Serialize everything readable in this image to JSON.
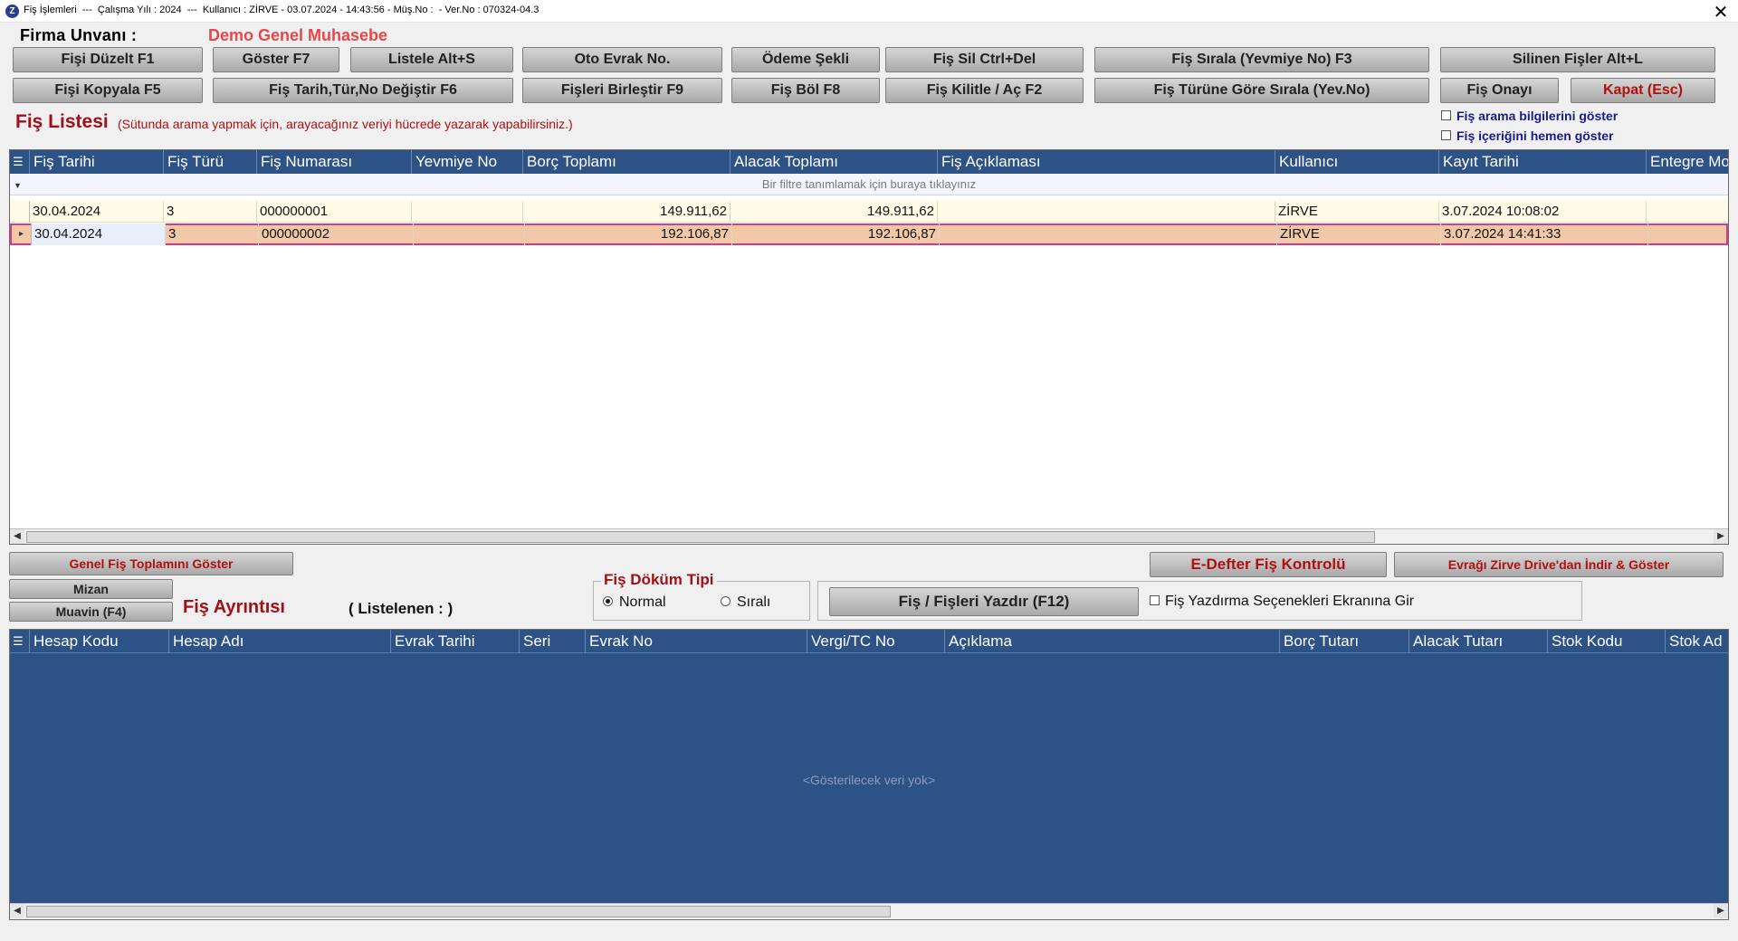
{
  "window": {
    "title": "Fiş İşlemleri  ---  Çalışma Yılı : 2024  ---  Kullanıcı : ZİRVE - 03.07.2024 - 14:43:56 - Müş.No :  - Ver.No : 070324-04.3",
    "close_glyph": "✕"
  },
  "header": {
    "firma_label": "Firma  Unvanı :",
    "firma_value": "Demo Genel Muhasebe"
  },
  "toolbar_row1": [
    "Fişi Düzelt F1",
    "Göster F7",
    "Listele Alt+S",
    "Oto Evrak No.",
    "Ödeme Şekli",
    "Fiş Sil Ctrl+Del",
    "Fiş Sırala (Yevmiye No) F3",
    "Silinen Fişler Alt+L"
  ],
  "toolbar_row2": [
    "Fişi Kopyala F5",
    "Fiş Tarih,Tür,No Değiştir F6",
    "Fişleri Birleştir F9",
    "Fiş Böl F8",
    "Fiş Kilitle / Aç F2",
    "Fiş Türüne Göre Sırala (Yev.No)",
    "Fiş Onayı",
    "Kapat (Esc)"
  ],
  "fis_listesi": {
    "title": "Fiş Listesi",
    "hint": "(Sütunda arama yapmak için, arayacağınız veriyi hücrede yazarak yapabilirsiniz.)",
    "check1": "Fiş arama bilgilerini göster",
    "check2": "Fiş içeriğini hemen göster",
    "columns": [
      "Fiş Tarihi",
      "Fiş Türü",
      "Fiş Numarası",
      "Yevmiye No",
      "Borç Toplamı",
      "Alacak Toplamı",
      "Fiş Açıklaması",
      "Kullanıcı",
      "Kayıt Tarihi",
      "Entegre Mo"
    ],
    "filter_text": "Bir filtre tanımlamak için buraya tıklayınız",
    "rows": [
      {
        "tarih": "30.04.2024",
        "tur": "3",
        "no": "000000001",
        "yevmiye": "",
        "borc": "149.911,62",
        "alacak": "149.911,62",
        "aciklama": "",
        "kullanici": "ZİRVE",
        "kayit": "3.07.2024 10:08:02"
      },
      {
        "tarih": "30.04.2024",
        "tur": "3",
        "no": "000000002",
        "yevmiye": "",
        "borc": "192.106,87",
        "alacak": "192.106,87",
        "aciklama": "",
        "kullanici": "ZİRVE",
        "kayit": "3.07.2024 14:41:33"
      }
    ]
  },
  "middle": {
    "genel_toplam_btn": "Genel Fiş Toplamını Göster",
    "mizan_btn": "Mizan",
    "muavin_btn": "Muavin (F4)",
    "fis_ayrintisi": "Fiş Ayrıntısı",
    "listelenen": "( Listelenen : )",
    "dokum_legend": "Fiş Döküm Tipi",
    "radio_normal": "Normal",
    "radio_sirali": "Sıralı",
    "yazdir_btn": "Fiş / Fişleri Yazdır (F12)",
    "yazdirma_check": "Fiş Yazdırma Seçenekleri Ekranına Gir",
    "edefter_btn": "E-Defter Fiş Kontrolü",
    "drive_btn": "Evrağı Zirve Drive'dan İndir & Göster"
  },
  "detail_grid": {
    "columns": [
      "Hesap Kodu",
      "Hesap Adı",
      "Evrak Tarihi",
      "Seri",
      "Evrak No",
      "Vergi/TC No",
      "Açıklama",
      "Borç Tutarı",
      "Alacak Tutarı",
      "Stok Kodu",
      "Stok Ad"
    ],
    "empty_text": "<Gösterilecek veri yok>"
  },
  "colors": {
    "grid_header": "#2d5286",
    "row_normal": "#fffbe6",
    "row_selected": "#f2c9a6",
    "accent_red": "#a0101a"
  }
}
